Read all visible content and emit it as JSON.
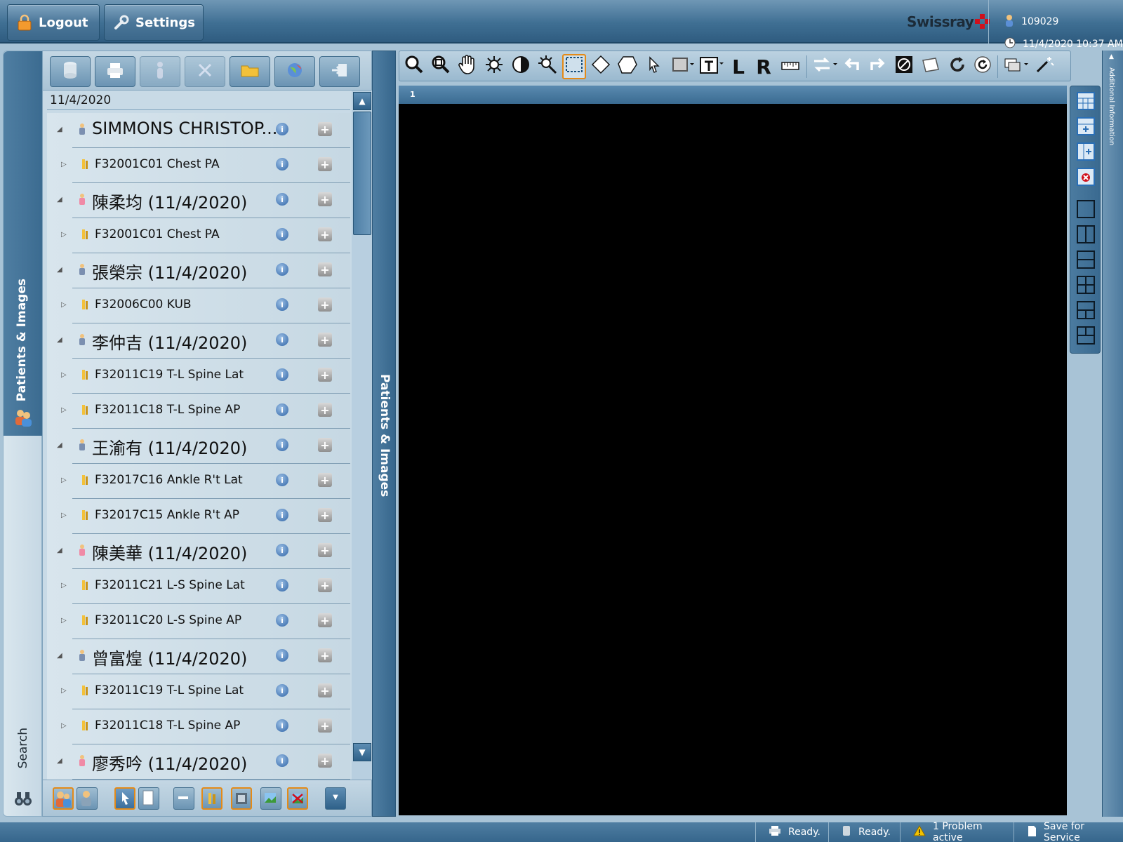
{
  "header": {
    "logout_label": "Logout",
    "settings_label": "Settings",
    "brand": "Swissray",
    "user_id": "109029",
    "datetime": "11/4/2020 10:37 AM"
  },
  "left_tabs": {
    "patients_images": "Patients & Images",
    "search": "Search"
  },
  "collapse_label": "Patients & Images",
  "right_panel_label": "Additional Information",
  "panel": {
    "date_header": "11/4/2020"
  },
  "tree": [
    {
      "type": "patient",
      "label": "SIMMONS CHRISTOP...",
      "gender": "male"
    },
    {
      "type": "study",
      "label": "F32001C01 Chest PA"
    },
    {
      "type": "patient",
      "label": "陳柔均 (11/4/2020)",
      "gender": "female"
    },
    {
      "type": "study",
      "label": "F32001C01 Chest PA"
    },
    {
      "type": "patient",
      "label": "張榮宗 (11/4/2020)",
      "gender": "male"
    },
    {
      "type": "study",
      "label": "F32006C00 KUB"
    },
    {
      "type": "patient",
      "label": "李仲吉 (11/4/2020)",
      "gender": "male"
    },
    {
      "type": "study",
      "label": "F32011C19 T-L Spine Lat"
    },
    {
      "type": "study",
      "label": "F32011C18 T-L Spine AP"
    },
    {
      "type": "patient",
      "label": "王渝有 (11/4/2020)",
      "gender": "male"
    },
    {
      "type": "study",
      "label": "F32017C16 Ankle R't Lat"
    },
    {
      "type": "study",
      "label": "F32017C15 Ankle R't AP"
    },
    {
      "type": "patient",
      "label": "陳美華 (11/4/2020)",
      "gender": "female"
    },
    {
      "type": "study",
      "label": "F32011C21 L-S Spine Lat"
    },
    {
      "type": "study",
      "label": "F32011C20 L-S Spine AP"
    },
    {
      "type": "patient",
      "label": "曾富煌 (11/4/2020)",
      "gender": "male"
    },
    {
      "type": "study",
      "label": "F32011C19 T-L Spine Lat"
    },
    {
      "type": "study",
      "label": "F32011C18 T-L Spine AP"
    },
    {
      "type": "patient",
      "label": "廖秀吟 (11/4/2020)",
      "gender": "female"
    }
  ],
  "viewer": {
    "viewport_number": "1",
    "marker_left": "L",
    "marker_right": "R"
  },
  "status": {
    "print": "Ready.",
    "storage": "Ready.",
    "problems": "1 Problem active",
    "service": "Save for Service"
  },
  "colors": {
    "accent_selected": "#e48a17",
    "image_background": "#000000",
    "brand_red": "#d0101c"
  }
}
